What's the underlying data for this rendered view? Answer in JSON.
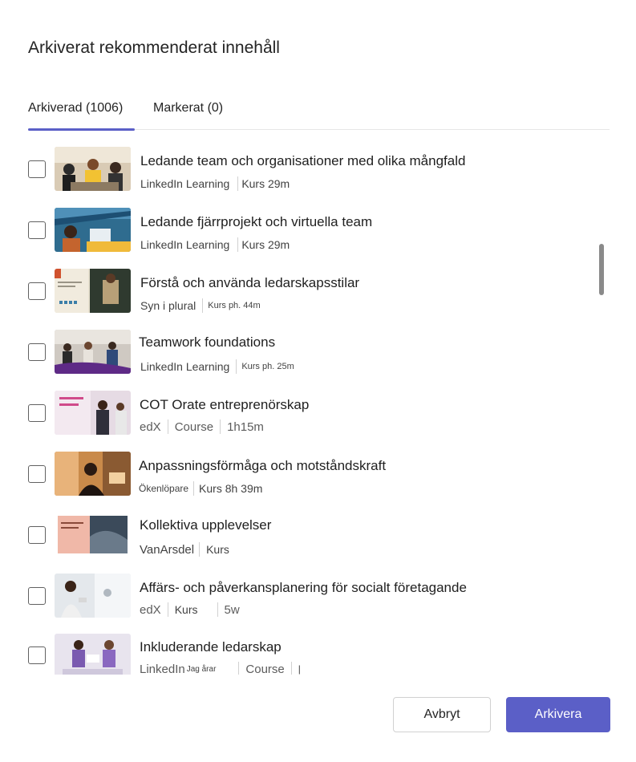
{
  "dialog": {
    "title": "Arkiverat rekommenderat innehåll",
    "tabs": [
      {
        "label": "Arkiverad (1006)",
        "active": true
      },
      {
        "label": "Markerat (0)",
        "active": false
      }
    ],
    "items": [
      {
        "title": "Ledande team och organisationer med olika mångfald",
        "provider": "LinkedIn Learning",
        "info": "Kurs 29m"
      },
      {
        "title": "Ledande fjärrprojekt och virtuella team",
        "provider": "LinkedIn Learning",
        "info": "Kurs 29m"
      },
      {
        "title": "Förstå och använda ledarskapsstilar",
        "provider": "Syn i plural",
        "info": "Kurs ph. 44m"
      },
      {
        "title": "Teamwork foundations",
        "provider": "LinkedIn Learning",
        "info": "Kurs ph. 25m"
      },
      {
        "title": "COT Orate entreprenörskap",
        "provider": "edX",
        "info": "Course",
        "duration": "1h15m"
      },
      {
        "title": "Anpassningsförmåga och motståndskraft",
        "provider": "Ökenlöpare",
        "info": "Kurs 8h 39m"
      },
      {
        "title": "Kollektiva upplevelser",
        "provider": "VanArsdel",
        "info": "Kurs"
      },
      {
        "title": "Affärs- och påverkansplanering för socialt företagande",
        "provider": "edX",
        "info": "Kurs",
        "duration": "5w"
      },
      {
        "title": "Inkluderande ledarskap",
        "provider": "LinkedIn",
        "provider_suffix": "Jag årar",
        "info": "Course",
        "duration": "|"
      }
    ],
    "buttons": {
      "cancel": "Avbryt",
      "archive": "Arkivera"
    },
    "colors": {
      "accent": "#5b5fc7"
    }
  }
}
